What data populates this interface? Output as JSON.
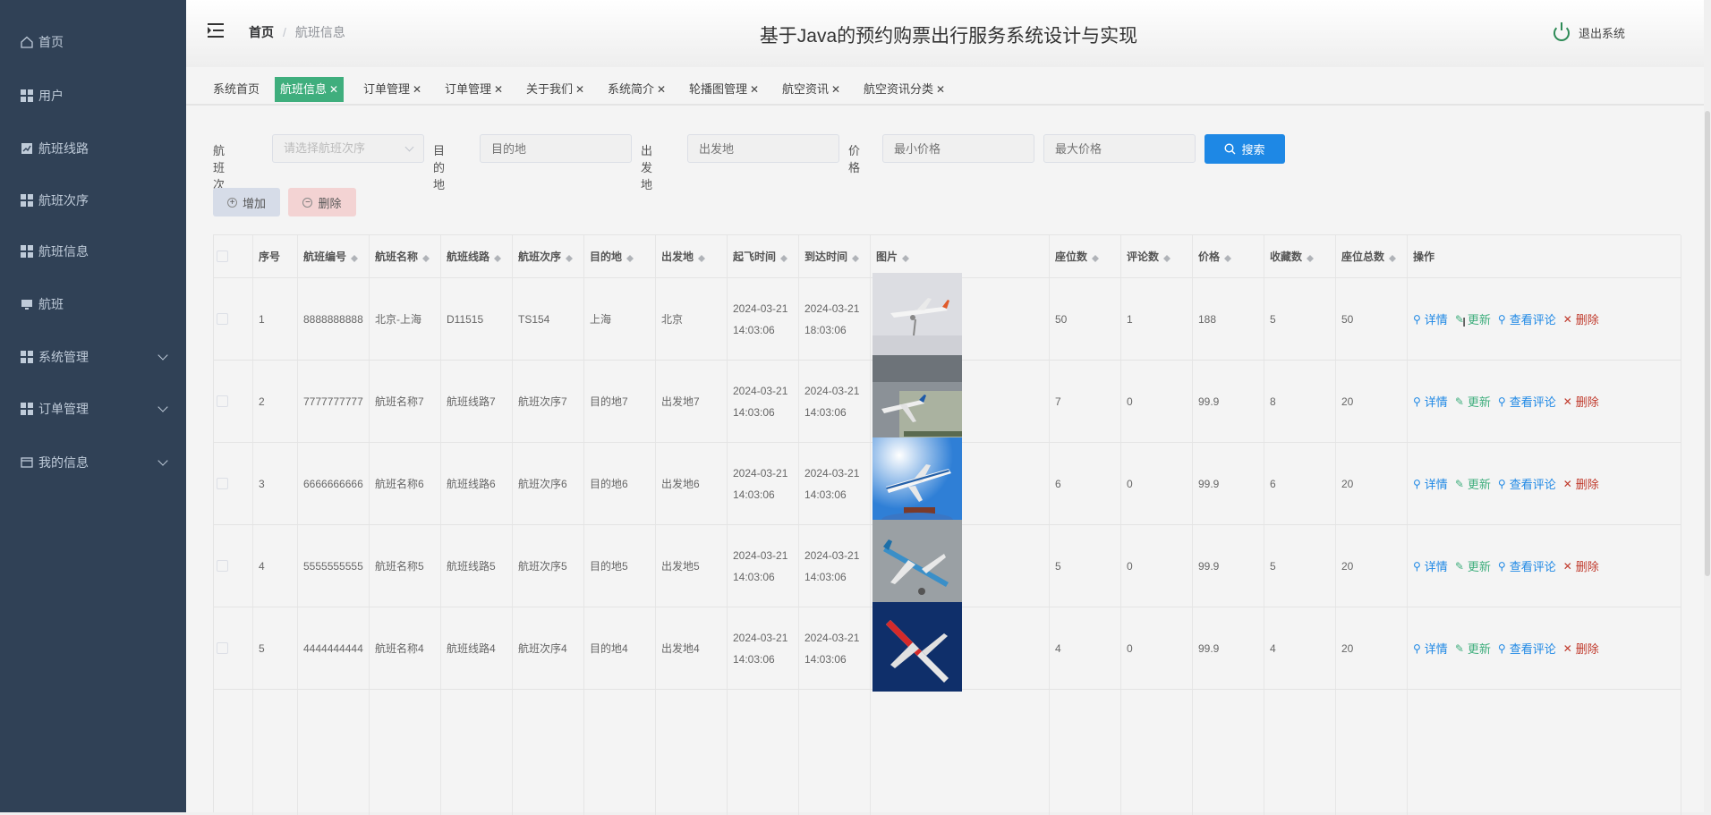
{
  "sidebar": {
    "items": [
      {
        "label": "首页",
        "icon": "home-icon"
      },
      {
        "label": "用户",
        "icon": "grid-icon"
      },
      {
        "label": "航班线路",
        "icon": "chart-icon"
      },
      {
        "label": "航班次序",
        "icon": "grid-icon"
      },
      {
        "label": "航班信息",
        "icon": "grid-icon"
      },
      {
        "label": "航班",
        "icon": "monitor-icon"
      },
      {
        "label": "系统管理",
        "icon": "grid-icon"
      },
      {
        "label": "订单管理",
        "icon": "grid-icon"
      },
      {
        "label": "我的信息",
        "icon": "card-icon"
      }
    ]
  },
  "header": {
    "breadcrumb_home": "首页",
    "breadcrumb_current": "航班信息",
    "title": "基于Java的预约购票出行服务系统设计与实现",
    "logout": "退出系统"
  },
  "tabs": [
    {
      "label": "系统首页",
      "closable": false
    },
    {
      "label": "航班信息",
      "closable": true,
      "active": true
    },
    {
      "label": "订单管理",
      "closable": true
    },
    {
      "label": "订单管理",
      "closable": true
    },
    {
      "label": "关于我们",
      "closable": true
    },
    {
      "label": "系统简介",
      "closable": true
    },
    {
      "label": "轮播图管理",
      "closable": true
    },
    {
      "label": "航空资讯",
      "closable": true
    },
    {
      "label": "航空资讯分类",
      "closable": true
    }
  ],
  "search": {
    "order_label": "航班次序",
    "order_placeholder": "请选择航班次序",
    "dest_label": "目的地",
    "dest_placeholder": "目的地",
    "origin_label": "出发地",
    "origin_placeholder": "出发地",
    "price_label": "价格",
    "min_placeholder": "最小价格",
    "max_placeholder": "最大价格",
    "search_button": "搜索"
  },
  "actions": {
    "add": "增加",
    "delete": "删除"
  },
  "table": {
    "headers": [
      "序号",
      "航班编号",
      "航班名称",
      "航班线路",
      "航班次序",
      "目的地",
      "出发地",
      "起飞时间",
      "到达时间",
      "图片",
      "座位数",
      "评论数",
      "价格",
      "收藏数",
      "座位总数",
      "操作"
    ],
    "op_labels": {
      "detail": "详情",
      "update": "更新",
      "comments": "查看评论",
      "delete": "删除"
    },
    "rows": [
      {
        "idx": "1",
        "code": "8888888888",
        "name": "北京-上海",
        "route": "D11515",
        "order": "TS154",
        "dest": "上海",
        "origin": "北京",
        "dep_date": "2024-03-21",
        "dep_time": "14:03:06",
        "arr_date": "2024-03-21",
        "arr_time": "18:03:06",
        "seats": "50",
        "comments": "1",
        "price": "188",
        "favs": "5",
        "total": "50"
      },
      {
        "idx": "2",
        "code": "7777777777",
        "name": "航班名称7",
        "route": "航班线路7",
        "order": "航班次序7",
        "dest": "目的地7",
        "origin": "出发地7",
        "dep_date": "2024-03-21",
        "dep_time": "14:03:06",
        "arr_date": "2024-03-21",
        "arr_time": "14:03:06",
        "seats": "7",
        "comments": "0",
        "price": "99.9",
        "favs": "8",
        "total": "20"
      },
      {
        "idx": "3",
        "code": "6666666666",
        "name": "航班名称6",
        "route": "航班线路6",
        "order": "航班次序6",
        "dest": "目的地6",
        "origin": "出发地6",
        "dep_date": "2024-03-21",
        "dep_time": "14:03:06",
        "arr_date": "2024-03-21",
        "arr_time": "14:03:06",
        "seats": "6",
        "comments": "0",
        "price": "99.9",
        "favs": "6",
        "total": "20"
      },
      {
        "idx": "4",
        "code": "5555555555",
        "name": "航班名称5",
        "route": "航班线路5",
        "order": "航班次序5",
        "dest": "目的地5",
        "origin": "出发地5",
        "dep_date": "2024-03-21",
        "dep_time": "14:03:06",
        "arr_date": "2024-03-21",
        "arr_time": "14:03:06",
        "seats": "5",
        "comments": "0",
        "price": "99.9",
        "favs": "5",
        "total": "20"
      },
      {
        "idx": "5",
        "code": "4444444444",
        "name": "航班名称4",
        "route": "航班线路4",
        "order": "航班次序4",
        "dest": "目的地4",
        "origin": "出发地4",
        "dep_date": "2024-03-21",
        "dep_time": "14:03:06",
        "arr_date": "2024-03-21",
        "arr_time": "14:03:06",
        "seats": "4",
        "comments": "0",
        "price": "99.9",
        "favs": "4",
        "total": "20"
      }
    ]
  },
  "colors": {
    "sidebar_bg": "#304156",
    "active_tab": "#3fae7d",
    "primary": "#1e88e5",
    "danger": "#c0392b"
  }
}
